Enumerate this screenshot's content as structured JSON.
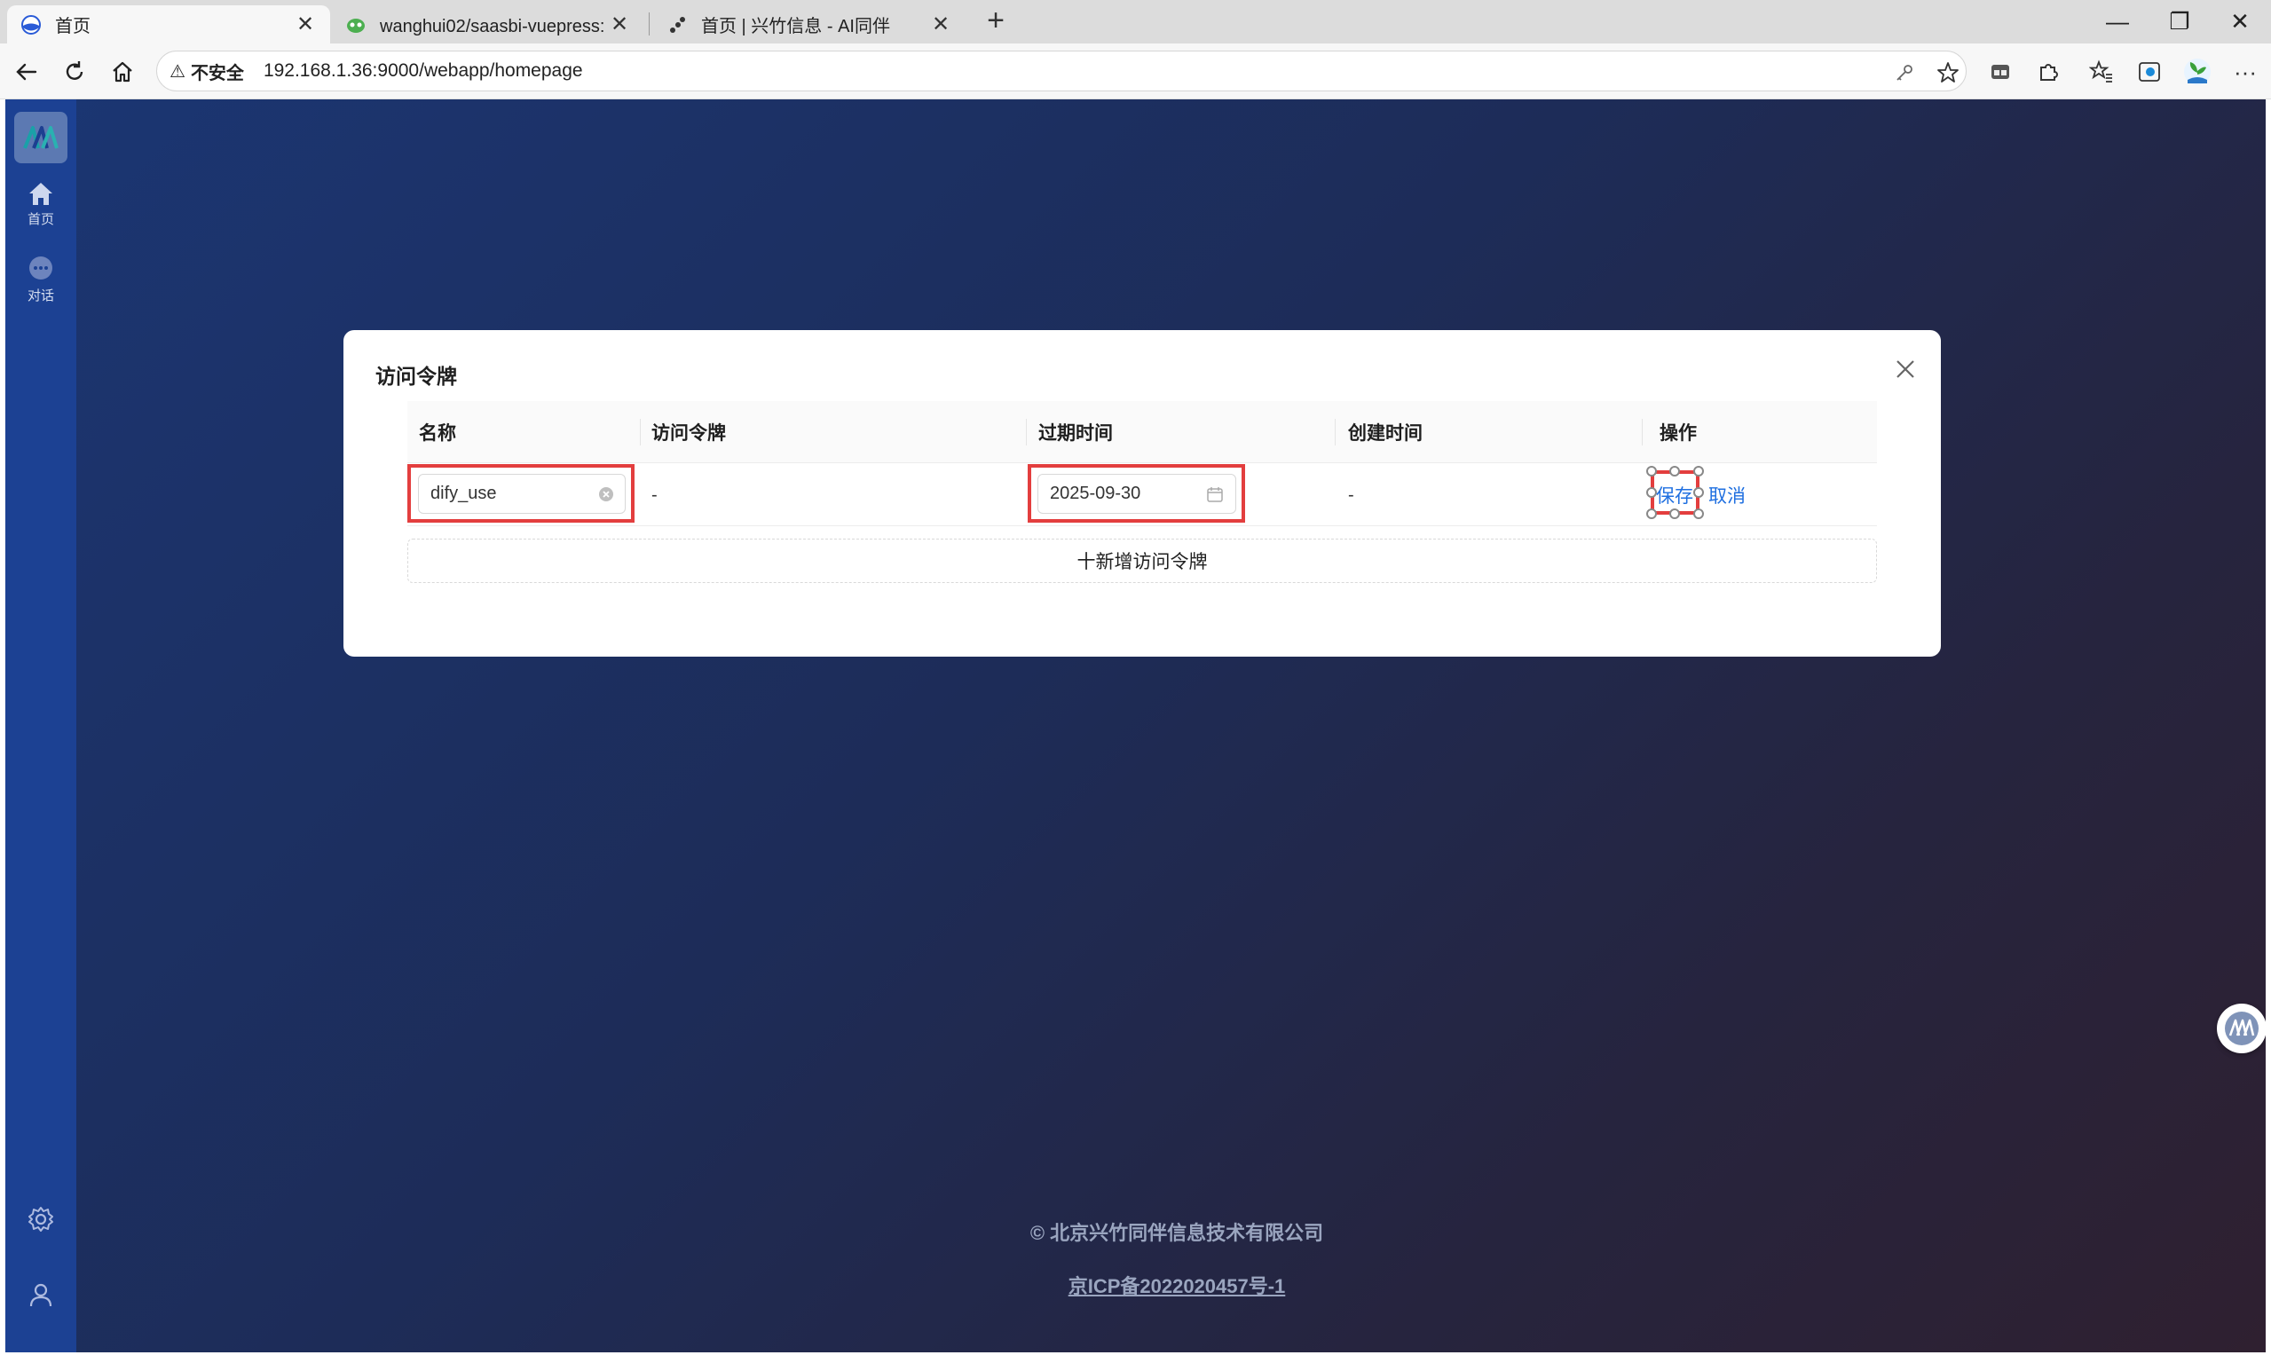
{
  "browser": {
    "tabs": [
      {
        "title": "首页",
        "close": "✕"
      },
      {
        "title": "wanghui02/saasbi-vuepress: 文档",
        "close": "✕"
      },
      {
        "title": "首页 | 兴竹信息 - AI同伴",
        "close": "✕"
      }
    ],
    "new_tab": "+",
    "window_controls": {
      "minimize": "—",
      "restore": "❐",
      "close": "✕"
    },
    "address": {
      "warning": "⚠",
      "insecure_label": "不安全",
      "url": "192.168.1.36:9000/webapp/homepage"
    },
    "menu": "···"
  },
  "sidebar": {
    "items": [
      {
        "label": "首页",
        "icon": "home-icon"
      },
      {
        "label": "对话",
        "icon": "chat-bubble-icon"
      }
    ],
    "bottom_icons": [
      "gear-icon",
      "user-icon"
    ]
  },
  "modal": {
    "title": "访问令牌",
    "columns": [
      "名称",
      "访问令牌",
      "过期时间",
      "创建时间",
      "操作"
    ],
    "row": {
      "name_value": "dify_use",
      "token": "-",
      "expire_value": "2025-09-30",
      "created": "-",
      "save": "保存",
      "cancel": "取消"
    },
    "add_label": "十新增访问令牌"
  },
  "footer": {
    "copyright": "© 北京兴竹同伴信息技术有限公司",
    "icp": "京ICP备2022020457号-1"
  },
  "colors": {
    "accent": "#1f6fe0",
    "highlight": "#e33e3e",
    "sidebar": "#1c4193"
  }
}
